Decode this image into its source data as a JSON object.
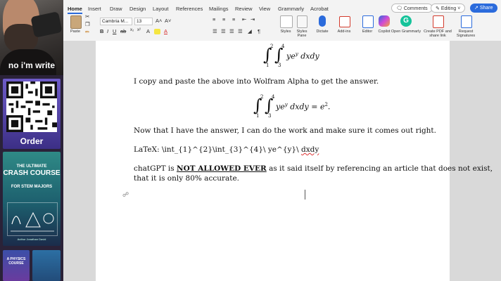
{
  "left_panel": {
    "webcam_caption": "no i'm write",
    "qr_label": "Order",
    "book1": {
      "line1": "THE ULTIMATE",
      "line2": "CRASH COURSE",
      "line3": "FOR STEM MAJORS",
      "author": "Author Jonathan David"
    },
    "book2_title": "A PHYSICS COURSE"
  },
  "ribbon": {
    "tabs": [
      "Home",
      "Insert",
      "Draw",
      "Design",
      "Layout",
      "References",
      "Mailings",
      "Review",
      "View",
      "Grammarly",
      "Acrobat"
    ],
    "active_tab": "Home",
    "comments_label": "Comments",
    "editing_label": "Editing",
    "share_label": "Share",
    "paste_label": "Paste",
    "font_name": "Cambria M...",
    "font_size": "13",
    "styles_label": "Styles",
    "styles_pane_label": "Styles Pane",
    "dictate_label": "Dictate",
    "addins_label": "Add-ins",
    "editor_label": "Editor",
    "copilot_label": "Copilot",
    "open_grammarly_label": "Open Grammarly",
    "create_pdf_label": "Create PDF and share link",
    "request_signatures_label": "Request Signatures",
    "colors": {
      "accent": "#2b6bdc",
      "grammarly": "#15c39a",
      "pdf": "#d33a2c",
      "highlight_yellow": "#f5e642",
      "font_red": "#d62f2f"
    }
  },
  "document": {
    "eq1": {
      "outer_upper": "2",
      "outer_lower": "1",
      "inner_upper": "4",
      "inner_lower": "3",
      "integrand": "ye",
      "exponent": "y",
      "differentials": "dxdy"
    },
    "para1": "I copy and paste the above into Wolfram Alpha to get the answer.",
    "eq2": {
      "outer_upper": "2",
      "outer_lower": "1",
      "inner_upper": "4",
      "inner_lower": "3",
      "integrand": "ye",
      "exponent": "y",
      "differentials": "dxdy",
      "equals": "=",
      "result_base": "e",
      "result_exp": "2",
      "end": "."
    },
    "para2": "Now that I have the answer, I can do the work and make sure it comes out right.",
    "latex_prefix": "LaTeX: \\int_{1}^{2}\\int_{3}^{4}\\ ye^{y}\\ ",
    "latex_squiggle": "dxdy",
    "para3_start": "chatGPT is ",
    "para3_bold": "NOT ALLOWED EVER",
    "para3_end": " as it said itself by referencing an article that does not exist,",
    "para3_line2": "that it is only 80% accurate."
  }
}
